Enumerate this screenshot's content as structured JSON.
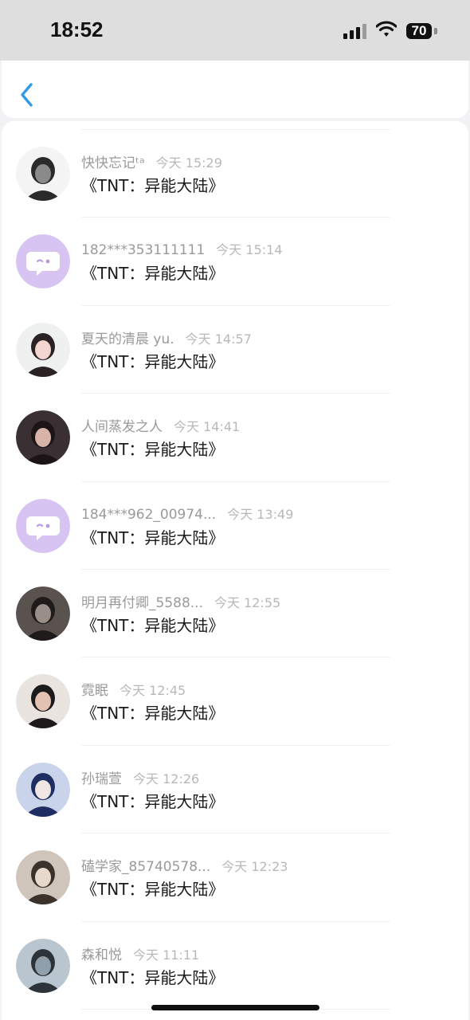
{
  "status": {
    "time": "18:52",
    "battery": "70"
  },
  "comments": [
    {
      "username": "快快忘记ᵗᵃ",
      "time": "今天 15:29",
      "title": "《TNT：异能大陆》",
      "avatar": "anime-sketch-avatar"
    },
    {
      "username": "182***353111111",
      "time": "今天 15:14",
      "title": "《TNT：异能大陆》",
      "avatar": "default-chat-avatar"
    },
    {
      "username": "夏天的清晨 yu.",
      "time": "今天 14:57",
      "title": "《TNT：异能大陆》",
      "avatar": "anime-girl-avatar"
    },
    {
      "username": "人间蒸发之人",
      "time": "今天 14:41",
      "title": "《TNT：异能大陆》",
      "avatar": "dark-anime-avatar"
    },
    {
      "username": "184***962_00974...",
      "time": "今天 13:49",
      "title": "《TNT：异能大陆》",
      "avatar": "default-chat-avatar"
    },
    {
      "username": "明月再付卿_5588...",
      "time": "今天 12:55",
      "title": "《TNT：异能大陆》",
      "avatar": "photo-avatar"
    },
    {
      "username": "霓眠",
      "time": "今天 12:45",
      "title": "《TNT：异能大陆》",
      "avatar": "photo-avatar"
    },
    {
      "username": "孙瑞萱",
      "time": "今天 12:26",
      "title": "《TNT：异能大陆》",
      "avatar": "photo-avatar"
    },
    {
      "username": "磕学家_85740578...",
      "time": "今天 12:23",
      "title": "《TNT：异能大陆》",
      "avatar": "photo-avatar"
    },
    {
      "username": "森和悦",
      "time": "今天 11:11",
      "title": "《TNT：异能大陆》",
      "avatar": "silhouette-avatar"
    }
  ],
  "colors": {
    "accent": "#2f9be8",
    "default_avatar": "#d8c4f2"
  }
}
